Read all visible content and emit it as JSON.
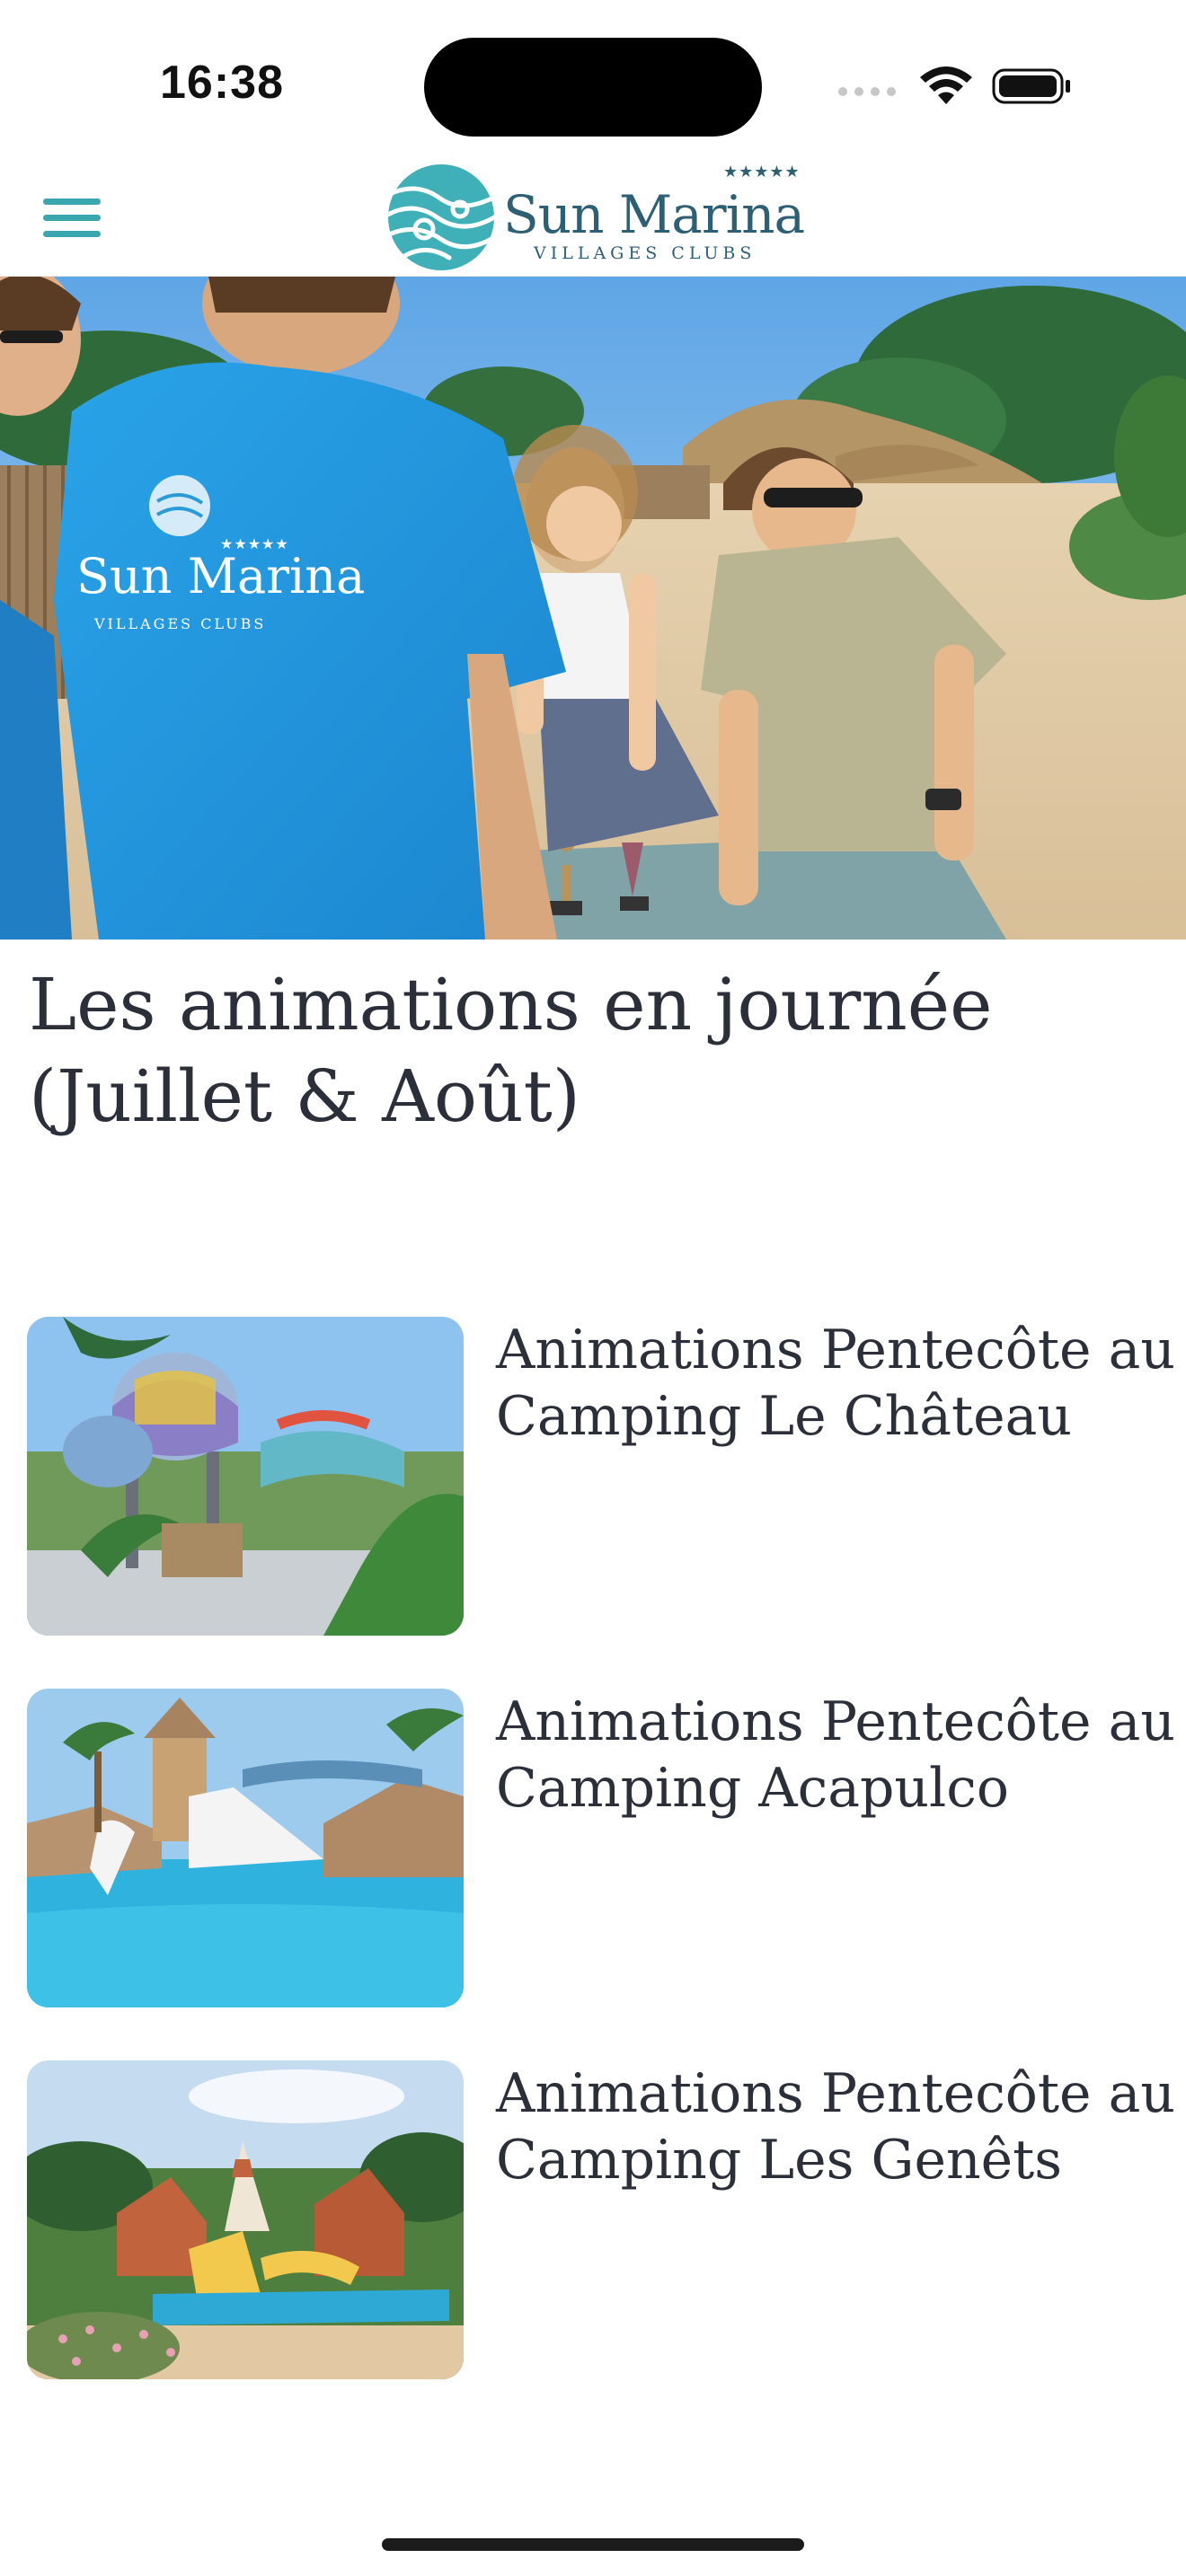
{
  "status_bar": {
    "time": "16:38"
  },
  "header": {
    "logo_name": "Sun Marina",
    "logo_subtitle": "VILLAGES CLUBS",
    "logo_stars": "★★★★★",
    "accent_color": "#3aa6b0",
    "menu_icon": "hamburger-menu-icon"
  },
  "hero": {
    "shirt_brand": "Sun Marina",
    "shirt_subtitle": "VILLAGES CLUBS",
    "shirt_stars": "★★★★★"
  },
  "section": {
    "title": "Les animations en journée (Juillet & Août)"
  },
  "articles": [
    {
      "title": "Animations Pentecôte au Camping Le Château"
    },
    {
      "title": "Animations Pentecôte au Camping Acapulco"
    },
    {
      "title": "Animations Pentecôte au Camping Les Genêts"
    }
  ]
}
